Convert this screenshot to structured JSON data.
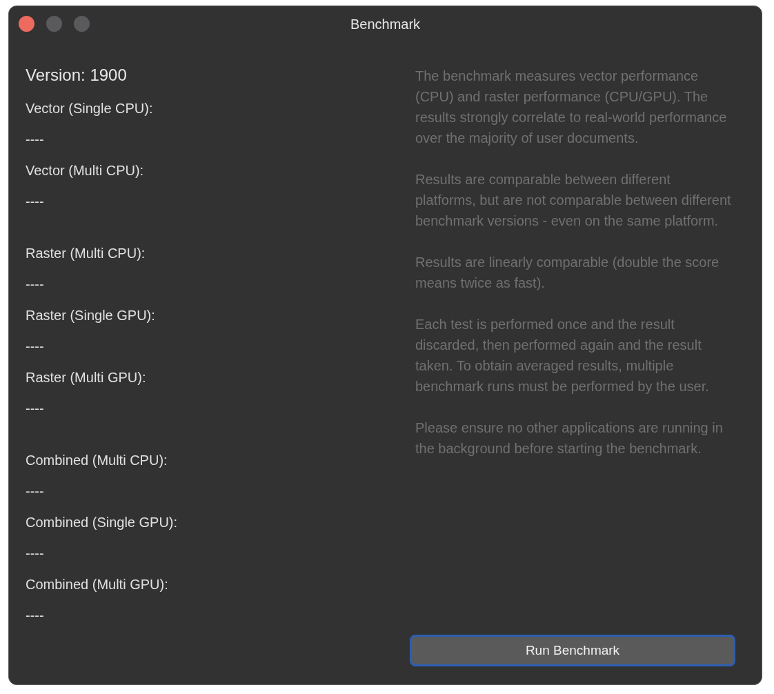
{
  "window": {
    "title": "Benchmark"
  },
  "version": "Version: 1900",
  "result_groups": [
    {
      "items": [
        {
          "label": "Vector (Single CPU):",
          "value": "----"
        },
        {
          "label": "Vector (Multi CPU):",
          "value": "----"
        }
      ]
    },
    {
      "items": [
        {
          "label": "Raster (Multi CPU):",
          "value": "----"
        },
        {
          "label": "Raster (Single GPU):",
          "value": "----"
        },
        {
          "label": "Raster (Multi GPU):",
          "value": "----"
        }
      ]
    },
    {
      "items": [
        {
          "label": "Combined (Multi CPU):",
          "value": "----"
        },
        {
          "label": "Combined (Single GPU):",
          "value": "----"
        },
        {
          "label": "Combined (Multi GPU):",
          "value": "----"
        }
      ]
    }
  ],
  "description": [
    "The benchmark measures vector performance (CPU) and raster performance (CPU/GPU). The results strongly correlate to real-world performance over the majority of user documents.",
    "Results are comparable between different platforms, but are not comparable between different benchmark versions - even on the same platform.",
    "Results are linearly comparable (double the score means twice as fast).",
    "Each test is performed once and the result discarded, then performed again and the result taken. To obtain averaged results, multiple benchmark runs must be performed by the user.",
    "Please ensure no other applications are running in the background before starting the benchmark."
  ],
  "run_button": {
    "label": "Run Benchmark",
    "focused": true
  }
}
